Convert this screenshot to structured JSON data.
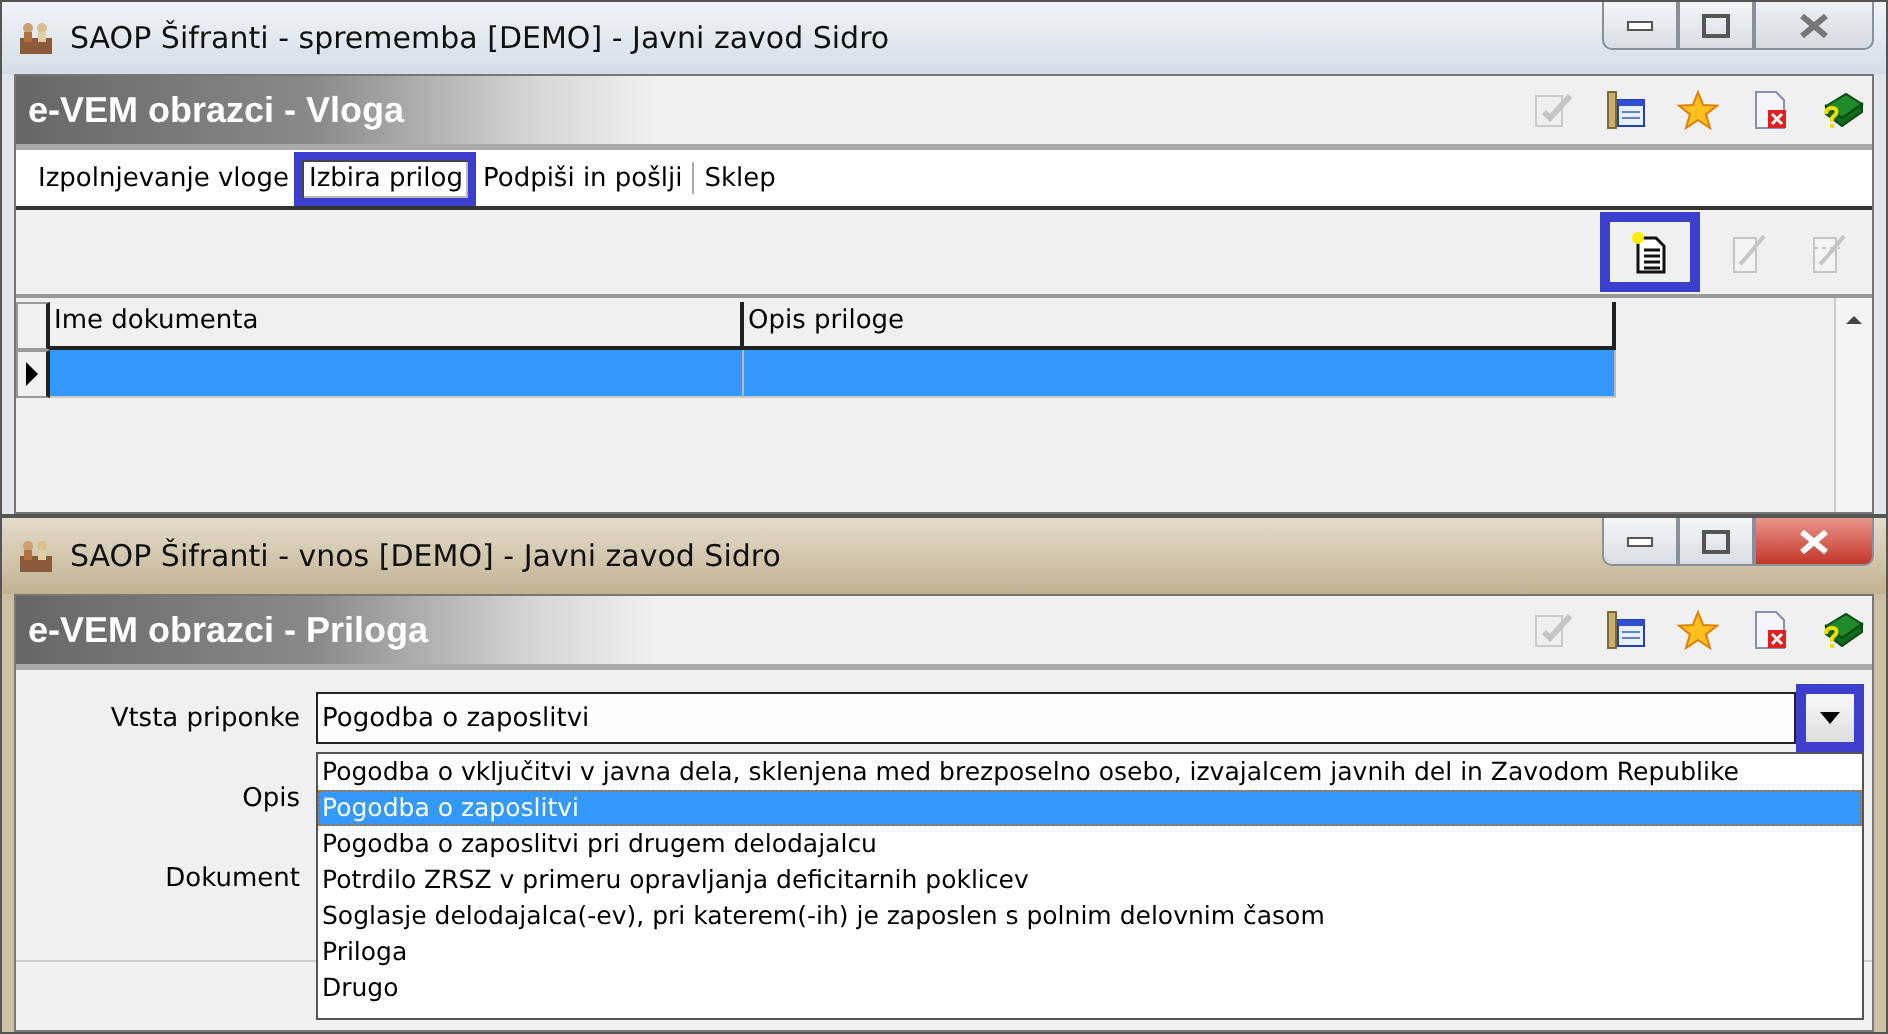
{
  "windows": [
    {
      "title": "SAOP Šifranti - sprememba [DEMO] - Javni zavod Sidro",
      "active": false,
      "form_title": "e-VEM obrazci - Vloga",
      "header_tools": [
        {
          "kind": "edit",
          "disabled": true
        },
        {
          "kind": "columns",
          "disabled": false
        },
        {
          "kind": "favorite",
          "disabled": false
        },
        {
          "kind": "close-document",
          "disabled": false
        },
        {
          "kind": "help",
          "disabled": false
        }
      ],
      "tabs": [
        {
          "label": "Izpolnjevanje vloge",
          "selected": false,
          "highlighted": false
        },
        {
          "label": "Izbira prilog",
          "selected": true,
          "highlighted": true
        },
        {
          "label": "Podpiši in pošlji",
          "selected": false,
          "highlighted": false
        },
        {
          "label": "Sklep",
          "selected": false,
          "highlighted": false
        }
      ],
      "toolbar": [
        {
          "kind": "new",
          "disabled": false,
          "highlighted": true
        },
        {
          "kind": "edit",
          "disabled": true,
          "highlighted": false
        },
        {
          "kind": "delete",
          "disabled": true,
          "highlighted": false
        }
      ],
      "grid": {
        "columns": [
          "Ime dokumenta",
          "Opis priloge"
        ],
        "rows": [
          {
            "selected": true
          }
        ]
      }
    },
    {
      "title": "SAOP Šifranti - vnos [DEMO] - Javni zavod Sidro",
      "active": true,
      "form_title": "e-VEM obrazci - Priloga",
      "header_tools": [
        {
          "kind": "edit",
          "disabled": true
        },
        {
          "kind": "columns",
          "disabled": false
        },
        {
          "kind": "favorite",
          "disabled": false
        },
        {
          "kind": "close-document",
          "disabled": false
        },
        {
          "kind": "help",
          "disabled": false
        }
      ],
      "fields": [
        {
          "label": "Vtsta priponke",
          "kind": "combo",
          "value": "Pogodba o zaposlitvi",
          "expanded": true,
          "button_highlighted": true
        },
        {
          "label": "Opis",
          "kind": "text"
        },
        {
          "label": "Dokument",
          "kind": "file"
        }
      ],
      "options": [
        {
          "label": "Pogodba o vključitvi v javna dela, sklenjena med brezposelno osebo, izvajalcem javnih del in Zavodom Republike",
          "selected": false
        },
        {
          "label": "Pogodba o zaposlitvi",
          "selected": true
        },
        {
          "label": "Pogodba o zaposlitvi pri drugem delodajalcu",
          "selected": false
        },
        {
          "label": "Potrdilo ZRSZ v primeru opravljanja deficitarnih poklicev",
          "selected": false
        },
        {
          "label": "Soglasje delodajalca(-ev), pri katerem(-ih) je zaposlen s polnim delovnim časom",
          "selected": false
        },
        {
          "label": "Priloga",
          "selected": false
        },
        {
          "label": "Drugo",
          "selected": false
        }
      ]
    }
  ]
}
